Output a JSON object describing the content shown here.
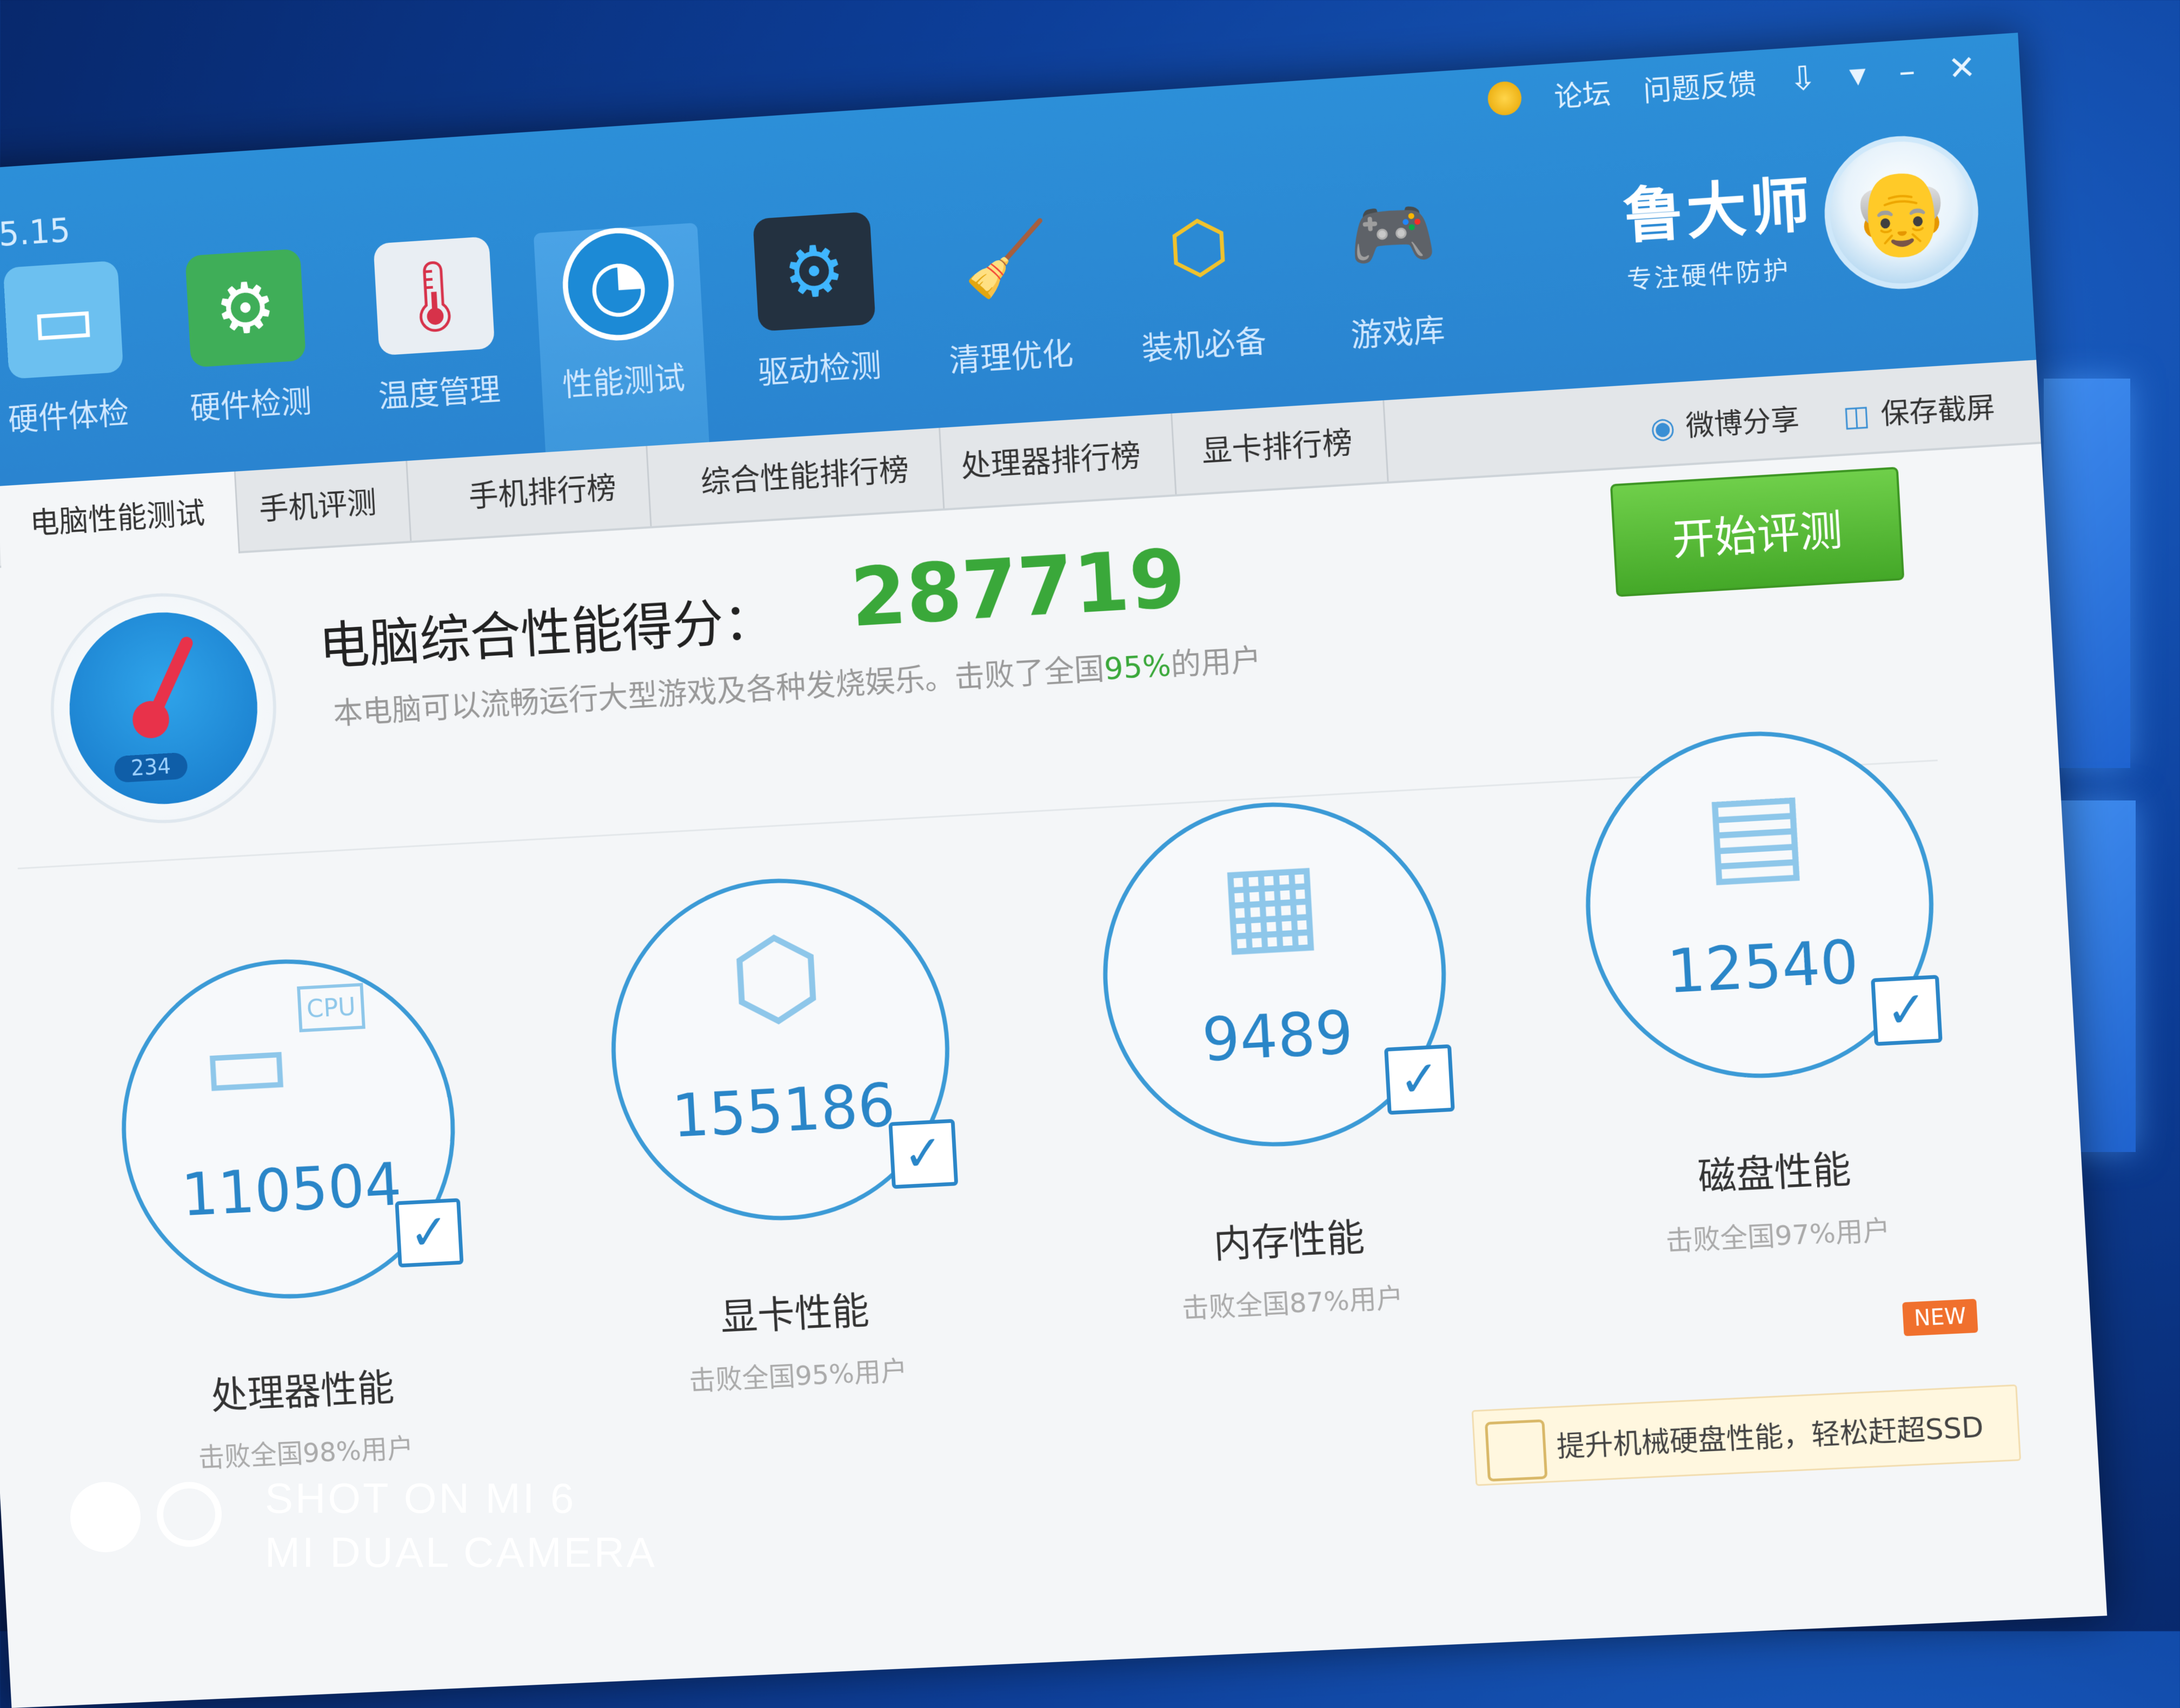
{
  "app": {
    "version": "5.15",
    "top_links": [
      "论坛",
      "问题反馈"
    ],
    "brand_name": "鲁大师",
    "brand_slogan": "专注硬件防护"
  },
  "toolbar": [
    {
      "label": "硬件体检",
      "icon": "monitor-icon"
    },
    {
      "label": "硬件检测",
      "icon": "graphics-card-icon"
    },
    {
      "label": "温度管理",
      "icon": "thermometer-icon"
    },
    {
      "label": "性能测试",
      "icon": "speedometer-icon"
    },
    {
      "label": "驱动检测",
      "icon": "gear-icon"
    },
    {
      "label": "清理优化",
      "icon": "broom-icon"
    },
    {
      "label": "装机必备",
      "icon": "box-icon"
    },
    {
      "label": "游戏库",
      "icon": "gamepad-icon"
    }
  ],
  "tabs": [
    "电脑性能测试",
    "手机评测",
    "手机排行榜",
    "综合性能排行榜",
    "处理器排行榜",
    "显卡排行榜"
  ],
  "share": {
    "weibo": "微博分享",
    "screenshot": "保存截屏"
  },
  "summary": {
    "gauge_label": "234",
    "title": "电脑综合性能得分：",
    "score": "287719",
    "desc_prefix": "本电脑可以流畅运行大型游戏及各种发烧娱乐。击败了全国",
    "desc_pct": "95%",
    "desc_suffix": "的用户",
    "start_button": "开始评测"
  },
  "cards": [
    {
      "name": "处理器性能",
      "value": "110504",
      "beat": "击败全国98%用户",
      "art_label": "CPU",
      "icon": "cpu-monitor-icon"
    },
    {
      "name": "显卡性能",
      "value": "155186",
      "beat": "击败全国95%用户",
      "icon": "cube-icon"
    },
    {
      "name": "内存性能",
      "value": "9489",
      "beat": "击败全国87%用户",
      "icon": "memory-icon"
    },
    {
      "name": "磁盘性能",
      "value": "12540",
      "beat": "击败全国97%用户",
      "icon": "disk-icon"
    }
  ],
  "promo": {
    "text": "提升机械硬盘性能，轻松赶超SSD",
    "badge": "NEW"
  },
  "watermark": {
    "line1": "SHOT ON MI 6",
    "line2": "MI DUAL CAMERA"
  },
  "colors": {
    "titlebar": "#2c8fd8",
    "score_green": "#3aa83a",
    "accent_blue": "#2a86c8",
    "button_green": "#44a828"
  }
}
